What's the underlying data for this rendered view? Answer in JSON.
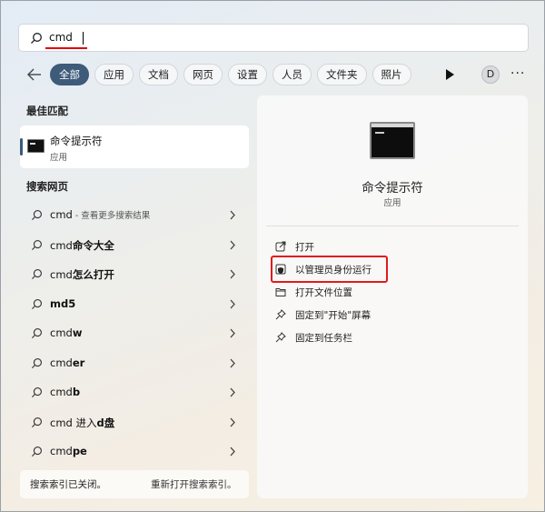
{
  "search": {
    "query": "cmd"
  },
  "filters": [
    "全部",
    "应用",
    "文档",
    "网页",
    "设置",
    "人员",
    "文件夹",
    "照片"
  ],
  "avatar_letter": "D",
  "more_label": "···",
  "best_match": {
    "section_title": "最佳匹配",
    "name": "命令提示符",
    "type": "应用"
  },
  "web": {
    "section_title": "搜索网页",
    "items": [
      {
        "main": "cmd",
        "sub": " - 查看更多搜索结果",
        "bold_part": ""
      },
      {
        "main": "cmd",
        "sub": "",
        "bold_part": "命令大全"
      },
      {
        "main": "cmd",
        "sub": "",
        "bold_part": "怎么打开"
      },
      {
        "main": "",
        "sub": "",
        "bold_part": "md5"
      },
      {
        "main": "cmd",
        "sub": "",
        "bold_part": "w"
      },
      {
        "main": "cmd",
        "sub": "",
        "bold_part": "er"
      },
      {
        "main": "cmd",
        "sub": "",
        "bold_part": "b"
      },
      {
        "main": "cmd 进入",
        "sub": "",
        "bold_part": "d盘"
      },
      {
        "main": "cmd",
        "sub": "",
        "bold_part": "pe"
      }
    ]
  },
  "footer": {
    "status": "搜索索引已关闭。",
    "link": "重新打开搜索索引。"
  },
  "detail": {
    "name": "命令提示符",
    "type": "应用",
    "actions": [
      {
        "label": "打开",
        "icon": "open-icon"
      },
      {
        "label": "以管理员身份运行",
        "icon": "shield-icon"
      },
      {
        "label": "打开文件位置",
        "icon": "folder-icon"
      },
      {
        "label": "固定到\"开始\"屏幕",
        "icon": "pin-icon"
      },
      {
        "label": "固定到任务栏",
        "icon": "pin-icon"
      }
    ]
  },
  "colors": {
    "accent": "#3e5b7a",
    "highlight": "#e01b1b"
  }
}
